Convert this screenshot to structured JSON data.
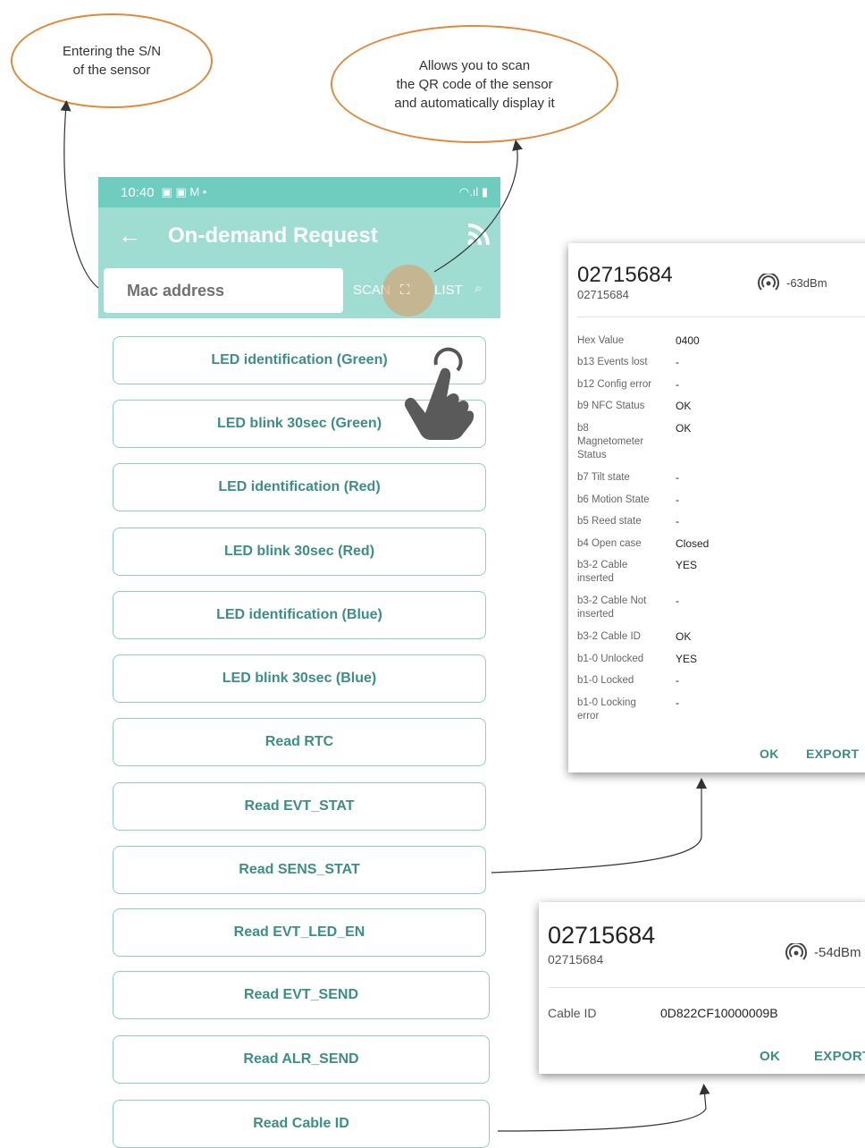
{
  "callouts": {
    "sn": {
      "line1": "Entering the S/N",
      "line2": "of the sensor"
    },
    "qr": {
      "line1": "Allows you to scan",
      "line2": "the QR code of the sensor",
      "line3": "and automatically display it"
    }
  },
  "status_bar": {
    "time": "10:40",
    "notif_icons": "▣ ▣ M •",
    "system_icons": "◠.ıl ▮"
  },
  "app_bar": {
    "back": "←",
    "title": "On-demand Request",
    "mac_placeholder": "Mac address",
    "scan_label": "SCAN",
    "qr_glyph": "⛶",
    "list_label": "LIST",
    "search_glyph": "⌕"
  },
  "commands": [
    "LED identification (Green)",
    "LED blink 30sec (Green)",
    "LED identification (Red)",
    "LED blink 30sec (Red)",
    "LED identification (Blue)",
    "LED blink 30sec (Blue)",
    "Read RTC",
    "Read EVT_STAT",
    "Read SENS_STAT",
    "Read EVT_LED_EN",
    "Read EVT_SEND",
    "Read ALR_SEND",
    "Read Cable ID"
  ],
  "dialog_status": {
    "title": "02715684",
    "subtitle": "02715684",
    "signal": "-63dBm",
    "rows": [
      {
        "label": "Hex Value",
        "value": "0400"
      },
      {
        "label": "b13 Events lost",
        "value": "-"
      },
      {
        "label": "b12 Config error",
        "value": "-"
      },
      {
        "label": "b9 NFC Status",
        "value": "OK"
      },
      {
        "label": "b8 Magnetometer Status",
        "value": "OK"
      },
      {
        "label": "b7 Tilt state",
        "value": "-"
      },
      {
        "label": "b6 Motion State",
        "value": "-"
      },
      {
        "label": "b5 Reed state",
        "value": "-"
      },
      {
        "label": "b4 Open case",
        "value": "Closed"
      },
      {
        "label": "b3-2 Cable inserted",
        "value": "YES"
      },
      {
        "label": "b3-2 Cable Not inserted",
        "value": "-"
      },
      {
        "label": "b3-2 Cable ID",
        "value": "OK"
      },
      {
        "label": "b1-0 Unlocked",
        "value": "YES"
      },
      {
        "label": "b1-0 Locked",
        "value": "-"
      },
      {
        "label": "b1-0 Locking error",
        "value": "-"
      }
    ],
    "ok": "OK",
    "export": "EXPORT"
  },
  "dialog_cable": {
    "title": "02715684",
    "subtitle": "02715684",
    "signal": "-54dBm",
    "label": "Cable ID",
    "value": "0D822CF10000009B",
    "ok": "OK",
    "export": "EXPORT"
  },
  "colors": {
    "accent": "#3b8f84",
    "appbar": "#9fddd3",
    "statusbar": "#6fcdbf",
    "callout": "#e08a3c"
  }
}
